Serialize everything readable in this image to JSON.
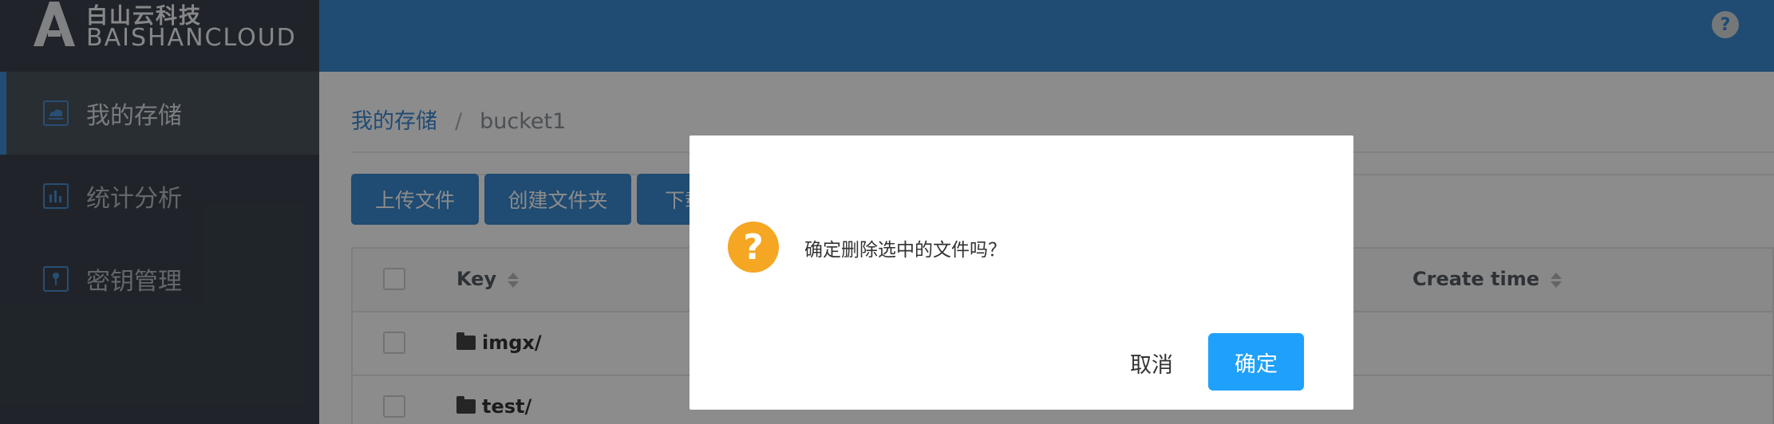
{
  "logo": {
    "cn": "白山云科技",
    "en": "BAISHANCLOUD"
  },
  "sidebar": {
    "items": [
      {
        "label": "我的存储",
        "icon": "storage-icon",
        "active": true
      },
      {
        "label": "统计分析",
        "icon": "bar-chart-icon",
        "active": false
      },
      {
        "label": "密钥管理",
        "icon": "key-icon",
        "active": false
      }
    ]
  },
  "header": {
    "help_icon": "help-icon",
    "help_glyph": "?"
  },
  "breadcrumb": {
    "root": "我的存储",
    "separator": "/",
    "current": "bucket1"
  },
  "toolbar": {
    "upload": "上传文件",
    "new_folder": "创建文件夹",
    "download": "下载"
  },
  "table": {
    "columns": {
      "key": "Key",
      "create_time": "Create time"
    },
    "rows": [
      {
        "name": "imgx/",
        "type": "folder"
      },
      {
        "name": "test/",
        "type": "folder"
      }
    ]
  },
  "dialog": {
    "icon": "question-icon",
    "icon_glyph": "?",
    "message": "确定删除选中的文件吗？",
    "cancel": "取消",
    "confirm": "确定"
  },
  "colors": {
    "header": "#3b89cf",
    "sidebar": "#3b434d",
    "primary_button": "#1ea0fb",
    "warning_icon": "#f5a623"
  }
}
